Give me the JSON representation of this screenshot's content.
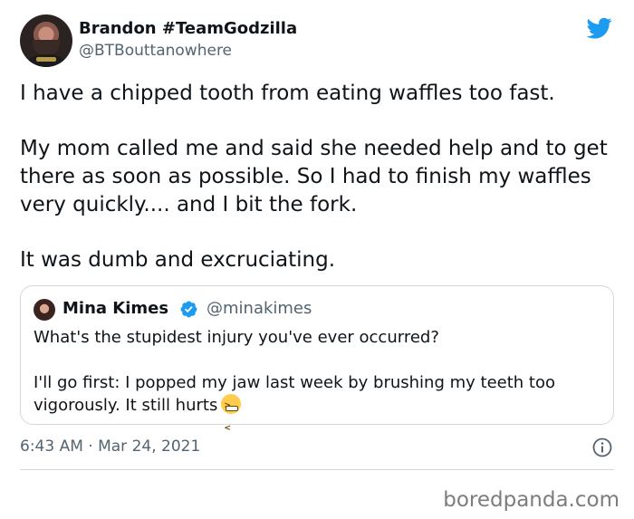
{
  "tweet": {
    "author": {
      "name": "Brandon #TeamGodzilla",
      "handle": "@BTBouttanowhere"
    },
    "paragraphs": [
      "I have a chipped tooth from eating waffles too fast.",
      "My mom called me and said she needed help and to get there as soon as possible. So I had to finish my waffles very quickly.... and I bit the fork.",
      "It was dumb and excruciating."
    ],
    "timestamp": "6:43 AM · Mar 24, 2021"
  },
  "quoted_tweet": {
    "author": {
      "name": "Mina Kimes",
      "handle": "@minakimes",
      "verified": true
    },
    "paragraphs": [
      "What's the stupidest injury you've ever occurred?",
      "I'll go first: I popped my jaw last week by brushing my teeth too vigorously. It still hurts"
    ],
    "emoji": "confounded-face"
  },
  "icons": {
    "platform": "twitter-bird-icon",
    "info": "info-icon",
    "verified": "verified-badge-icon"
  },
  "colors": {
    "twitter_blue": "#1d9bf0",
    "secondary_text": "#536471",
    "border": "#cfd9de"
  },
  "watermark": "boredpanda.com"
}
